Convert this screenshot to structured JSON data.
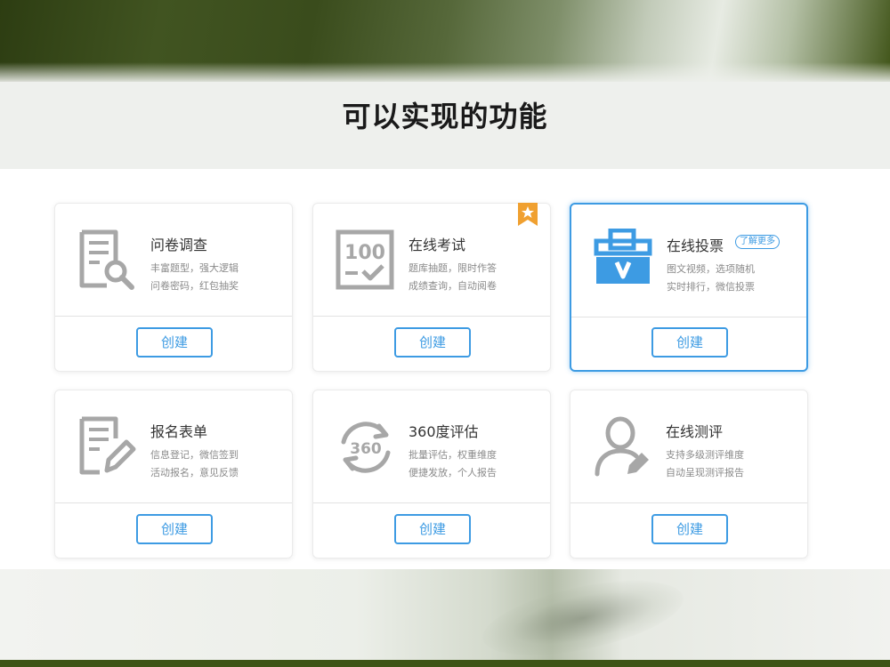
{
  "page": {
    "title": "可以实现的功能"
  },
  "colors": {
    "accent": "#3d9be3",
    "icon_gray": "#a7a7a7",
    "ribbon": "#f0a030"
  },
  "cards": [
    {
      "name": "问卷调查",
      "line1": "丰富题型，强大逻辑",
      "line2": "问卷密码，红包抽奖",
      "button": "创建",
      "icon": "survey-search-icon"
    },
    {
      "name": "在线考试",
      "line1": "题库抽题，限时作答",
      "line2": "成绩查询，自动阅卷",
      "button": "创建",
      "icon": "exam-score-icon",
      "badge": "star-ribbon-icon"
    },
    {
      "name": "在线投票",
      "line1": "图文视频，选项随机",
      "line2": "实时排行，微信投票",
      "button": "创建",
      "icon": "ballot-box-icon",
      "more_label": "了解更多"
    },
    {
      "name": "报名表单",
      "line1": "信息登记，微信签到",
      "line2": "活动报名，意见反馈",
      "button": "创建",
      "icon": "form-edit-icon"
    },
    {
      "name": "360度评估",
      "line1": "批量评估，权重维度",
      "line2": "便捷发放，个人报告",
      "button": "创建",
      "icon": "rotate-360-icon",
      "icon_text": "360"
    },
    {
      "name": "在线测评",
      "line1": "支持多级测评维度",
      "line2": "自动呈现测评报告",
      "button": "创建",
      "icon": "person-edit-icon"
    }
  ]
}
